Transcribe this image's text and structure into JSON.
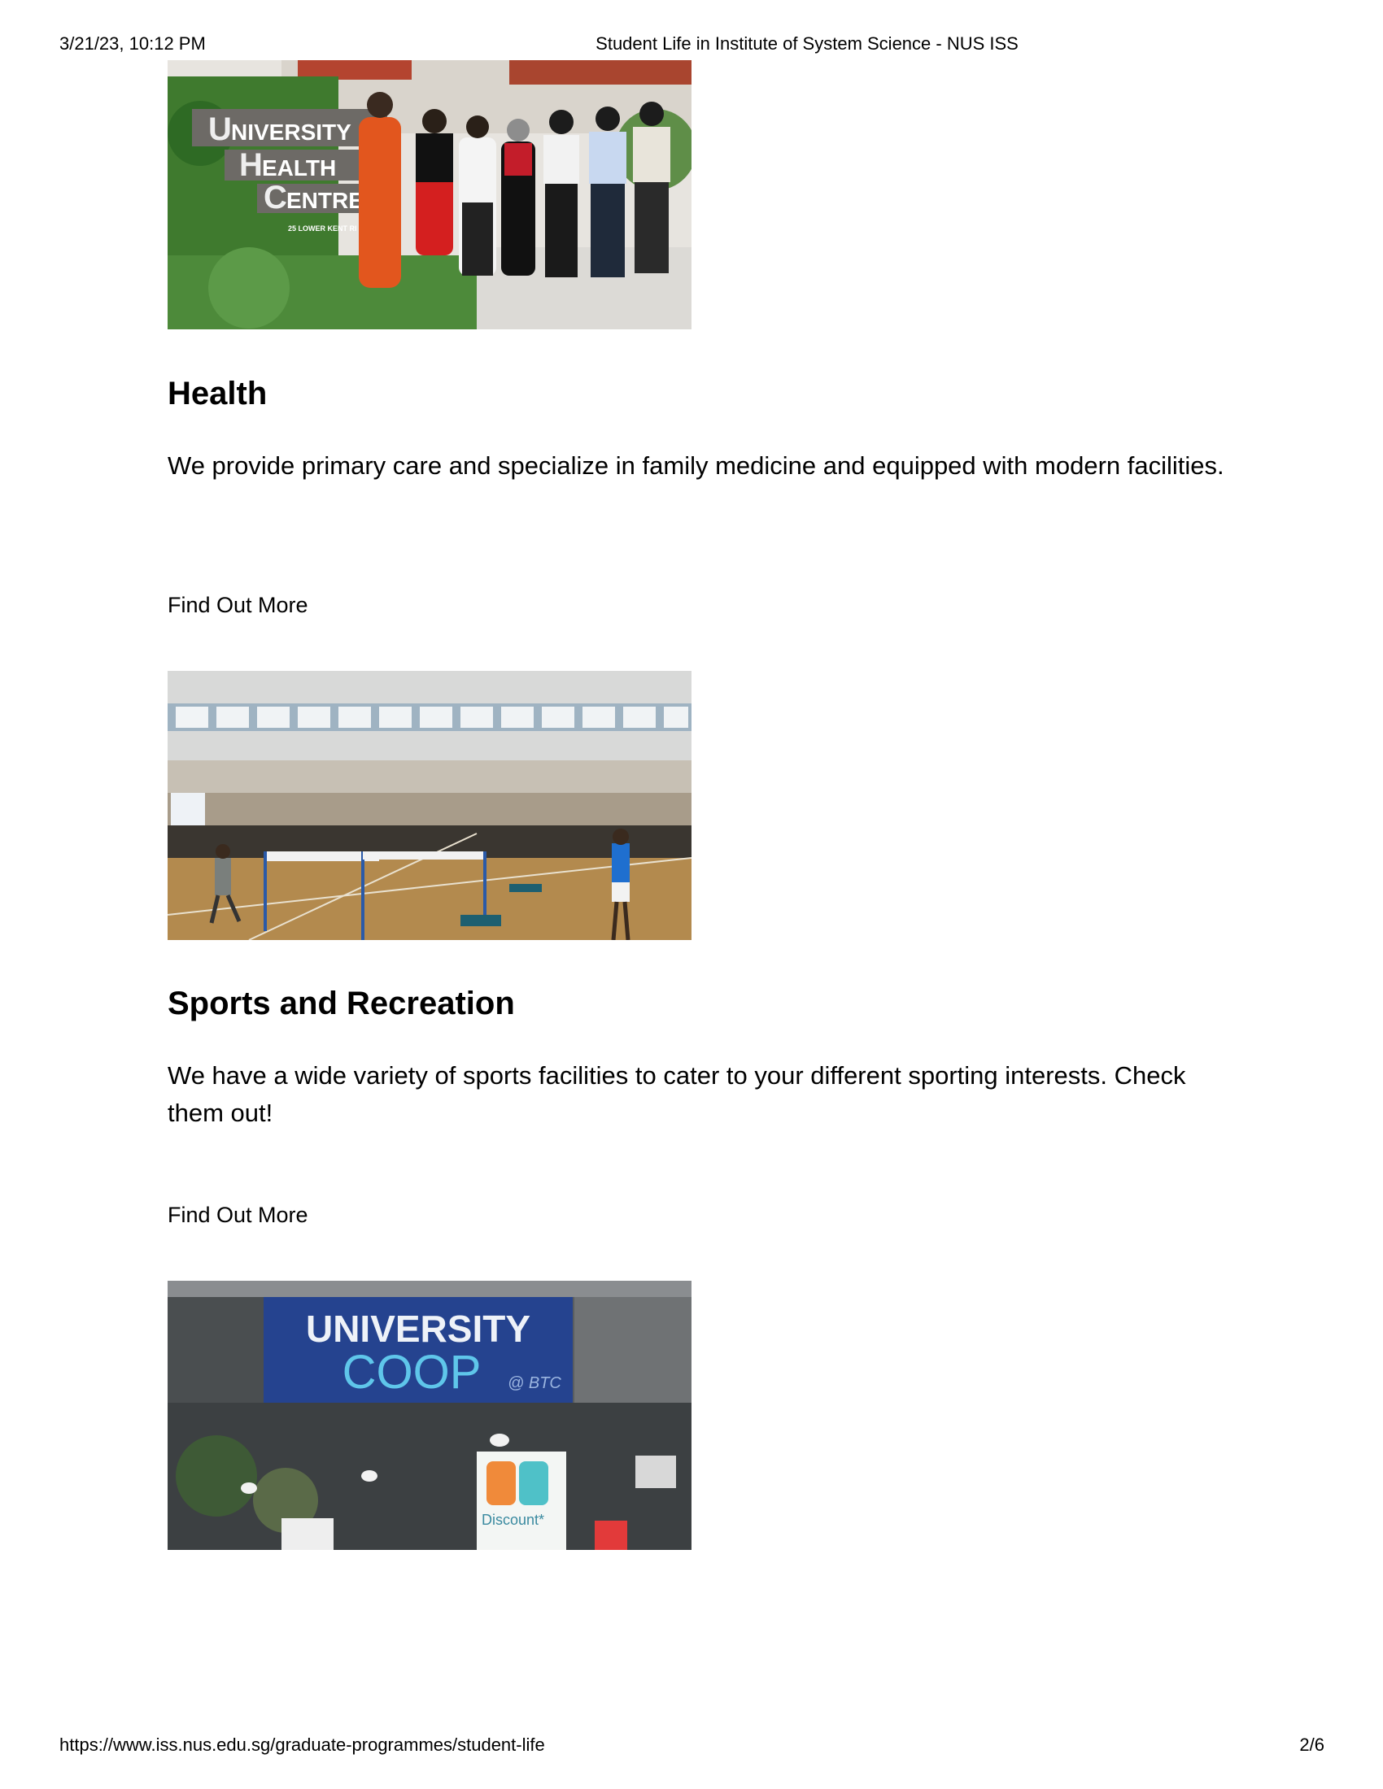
{
  "print_header": {
    "datetime": "3/21/23, 10:12 PM",
    "title": "Student Life in Institute of System Science - NUS ISS"
  },
  "sections": [
    {
      "heading": "Health",
      "text": "We provide primary care and specialize in family medicine and equipped with modern facilities.",
      "link": "Find Out More",
      "image_sign_lines": [
        "NIVERSITY",
        "EALTH",
        "ENTRE"
      ],
      "image_sign_initials": [
        "U",
        "H",
        "C"
      ],
      "image_sign_address": "25 LOWER KENT RI SINGAPO"
    },
    {
      "heading": "Sports and Recreation",
      "text": "We have a wide variety of sports facilities to cater to your different sporting interests. Check them out!",
      "link": "Find Out More"
    },
    {
      "image_sign_top": "UNIVERSITY",
      "image_sign_bottom": "COOP",
      "image_sign_tag": "@ BTC",
      "image_poster_text": "Discount*"
    }
  ],
  "print_footer": {
    "url": "https://www.iss.nus.edu.sg/graduate-programmes/student-life",
    "page": "2/6"
  }
}
